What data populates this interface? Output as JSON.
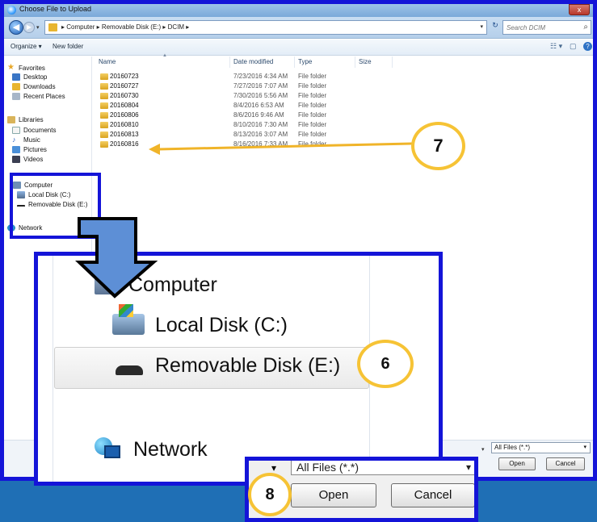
{
  "window": {
    "title": "Choose File to Upload",
    "close_label": "x"
  },
  "address": {
    "crumbs": "▸ Computer ▸ Removable Disk (E:) ▸ DCIM ▸",
    "search_placeholder": "Search DCIM"
  },
  "toolbar": {
    "organize_label": "Organize ▾",
    "new_folder_label": "New folder"
  },
  "nav": {
    "favorites": "Favorites",
    "desktop": "Desktop",
    "downloads": "Downloads",
    "recent": "Recent Places",
    "libraries": "Libraries",
    "documents": "Documents",
    "music": "Music",
    "pictures": "Pictures",
    "videos": "Videos",
    "computer": "Computer",
    "local_disk": "Local Disk (C:)",
    "removable_disk": "Removable Disk (E:)",
    "network": "Network"
  },
  "columns": {
    "name": "Name",
    "date": "Date modified",
    "type": "Type",
    "size": "Size"
  },
  "files": [
    {
      "name": "20160723",
      "date": "7/23/2016 4:34 AM",
      "type": "File folder"
    },
    {
      "name": "20160727",
      "date": "7/27/2016 7:07 AM",
      "type": "File folder"
    },
    {
      "name": "20160730",
      "date": "7/30/2016 5:56 AM",
      "type": "File folder"
    },
    {
      "name": "20160804",
      "date": "8/4/2016 6:53 AM",
      "type": "File folder"
    },
    {
      "name": "20160806",
      "date": "8/6/2016 9:46 AM",
      "type": "File folder"
    },
    {
      "name": "20160810",
      "date": "8/10/2016 7:30 AM",
      "type": "File folder"
    },
    {
      "name": "20160813",
      "date": "8/13/2016 3:07 AM",
      "type": "File folder"
    },
    {
      "name": "20160816",
      "date": "8/16/2016 7:33 AM",
      "type": "File folder"
    }
  ],
  "bottom": {
    "filter": "All Files (*.*)",
    "open_label": "Open",
    "cancel_label": "Cancel"
  },
  "zoom": {
    "computer": "Computer",
    "local_disk": "Local Disk (C:)",
    "removable_disk": "Removable Disk (E:)",
    "network": "Network"
  },
  "zoom2": {
    "filter": "All Files (*.*)",
    "open_label": "Open",
    "cancel_label": "Cancel"
  },
  "callouts": {
    "step6": "6",
    "step7": "7",
    "step8": "8"
  },
  "colors": {
    "annotation_frame": "#1414d8",
    "callout_ring": "#f6c335",
    "arrow_orange": "#f0b429",
    "big_arrow_fill": "#5d8fd6"
  }
}
